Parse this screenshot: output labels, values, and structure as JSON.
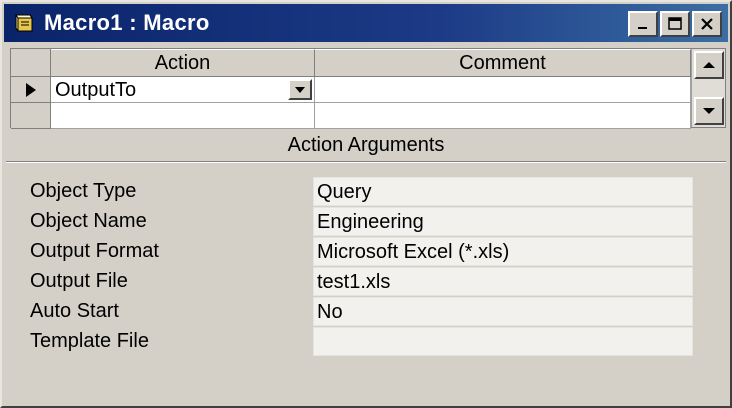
{
  "window": {
    "title": "Macro1 : Macro",
    "icon": "macro-icon"
  },
  "grid": {
    "columns": [
      "Action",
      "Comment"
    ],
    "rows": [
      {
        "action": "OutputTo",
        "comment": ""
      },
      {
        "action": "",
        "comment": ""
      }
    ]
  },
  "arguments": {
    "title": "Action Arguments",
    "fields": [
      {
        "label": "Object Type",
        "value": "Query"
      },
      {
        "label": "Object Name",
        "value": "Engineering"
      },
      {
        "label": "Output Format",
        "value": "Microsoft Excel (*.xls)"
      },
      {
        "label": "Output File",
        "value": "test1.xls"
      },
      {
        "label": "Auto Start",
        "value": "No"
      },
      {
        "label": "Template File",
        "value": ""
      }
    ]
  },
  "colors": {
    "titlebar": "#0a246a",
    "face": "#d4d0c8"
  }
}
